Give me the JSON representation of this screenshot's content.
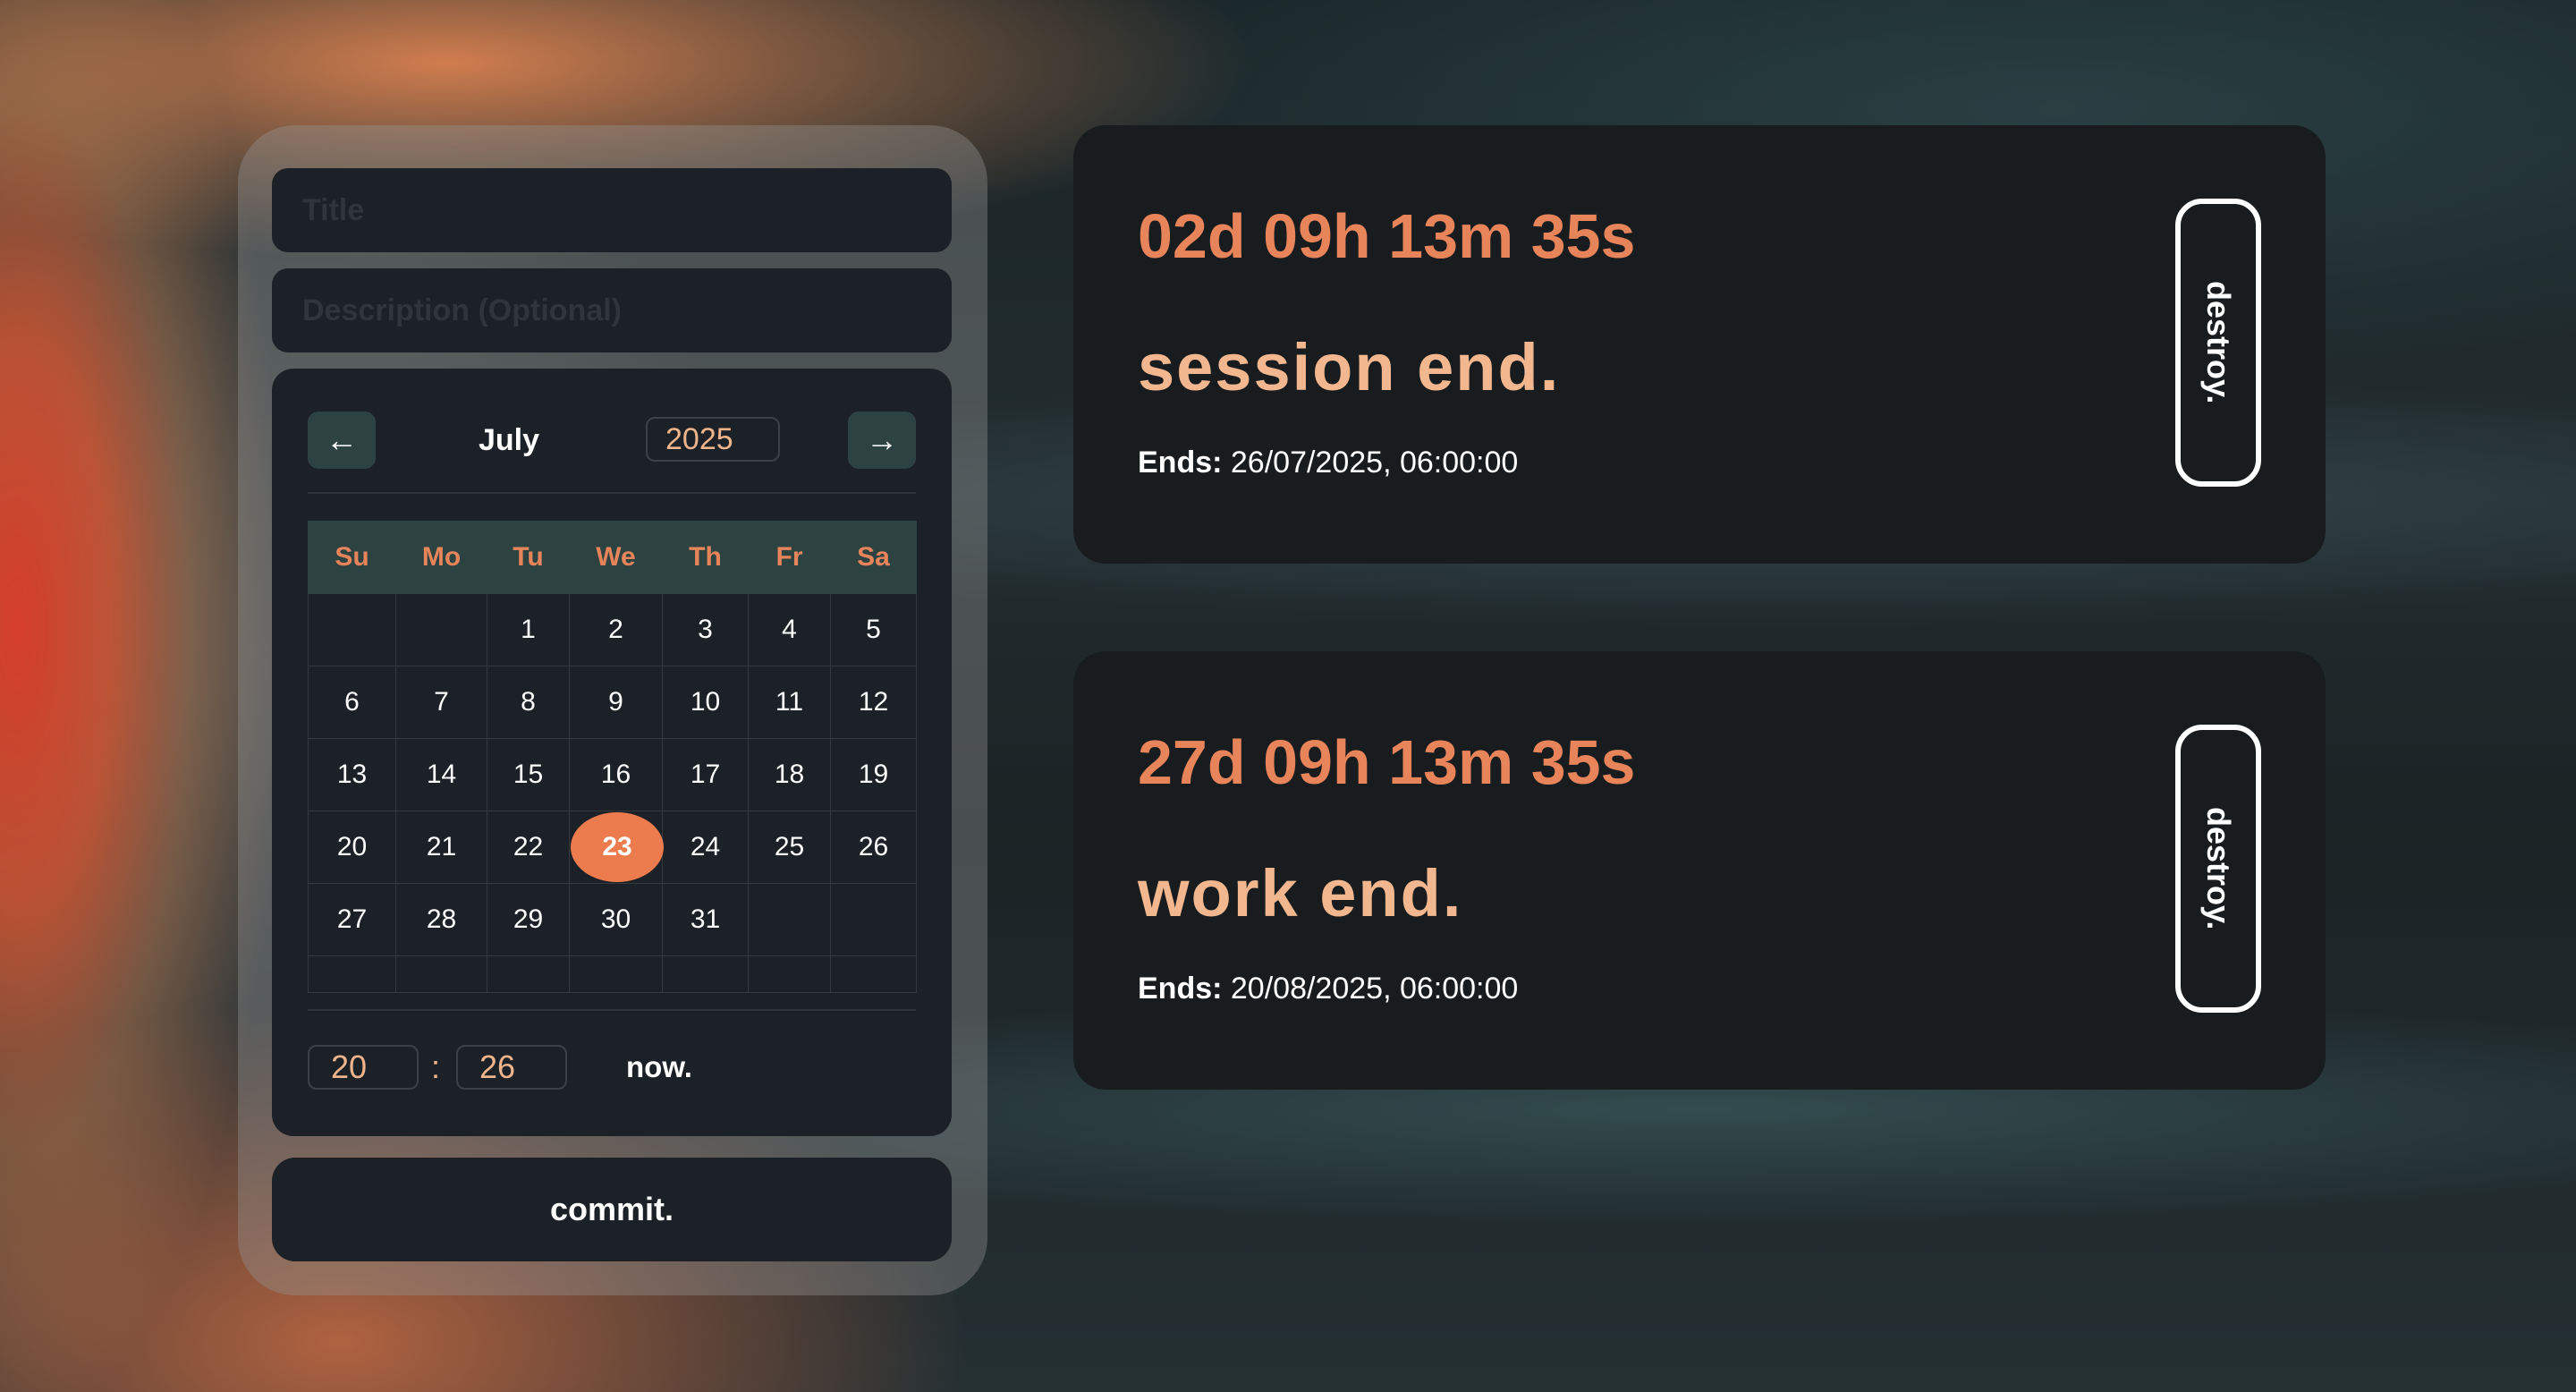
{
  "form": {
    "title_placeholder": "Title",
    "description_placeholder": "Description (Optional)",
    "calendar": {
      "prev_label": "←",
      "next_label": "→",
      "month": "July",
      "year": "2025",
      "weekdays": [
        "Su",
        "Mo",
        "Tu",
        "We",
        "Th",
        "Fr",
        "Sa"
      ],
      "weeks": [
        [
          "",
          "",
          "1",
          "2",
          "3",
          "4",
          "5"
        ],
        [
          "6",
          "7",
          "8",
          "9",
          "10",
          "11",
          "12"
        ],
        [
          "13",
          "14",
          "15",
          "16",
          "17",
          "18",
          "19"
        ],
        [
          "20",
          "21",
          "22",
          "23",
          "24",
          "25",
          "26"
        ],
        [
          "27",
          "28",
          "29",
          "30",
          "31",
          "",
          ""
        ],
        [
          "",
          "",
          "",
          "",
          "",
          "",
          ""
        ]
      ],
      "selected_day": "23"
    },
    "time": {
      "hours": "20",
      "separator": ":",
      "minutes": "26",
      "now_label": "now."
    },
    "commit_label": "commit."
  },
  "timers": [
    {
      "countdown": "02d 09h 13m 35s",
      "title": "session end.",
      "ends_label": "Ends:",
      "ends_value": " 26/07/2025, 06:00:00",
      "destroy_label": "destroy."
    },
    {
      "countdown": "27d 09h 13m 35s",
      "title": "work end.",
      "ends_label": "Ends:",
      "ends_value": " 20/08/2025, 06:00:00",
      "destroy_label": "destroy."
    }
  ],
  "colors": {
    "accent": "#ec7c4e",
    "countdown": "#e8845a",
    "title_text": "#f2b78e",
    "card_bg": "#181c1f",
    "calendar_header_bg": "#2d4342"
  }
}
